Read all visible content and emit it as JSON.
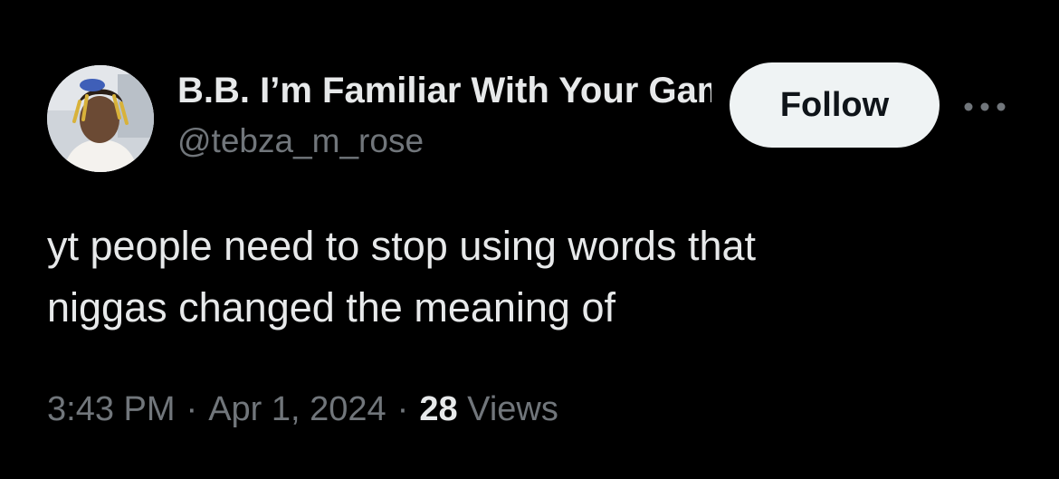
{
  "author": {
    "display_name": "B.B. I’m Familiar With Your Game",
    "handle": "@tebza_m_rose"
  },
  "actions": {
    "follow_label": "Follow",
    "more_icon": "more-horizontal-icon"
  },
  "tweet": {
    "lines": [
      "yt people need to stop using words that",
      "niggas changed the meaning of"
    ]
  },
  "meta": {
    "time": "3:43 PM",
    "separator": "·",
    "date": "Apr 1, 2024",
    "views_count": "28",
    "views_label": "Views"
  },
  "colors": {
    "background": "#000000",
    "primary_text": "#e7e9ea",
    "secondary_text": "#71767b",
    "follow_button_bg": "#eff3f4",
    "follow_button_text": "#0f1419"
  }
}
